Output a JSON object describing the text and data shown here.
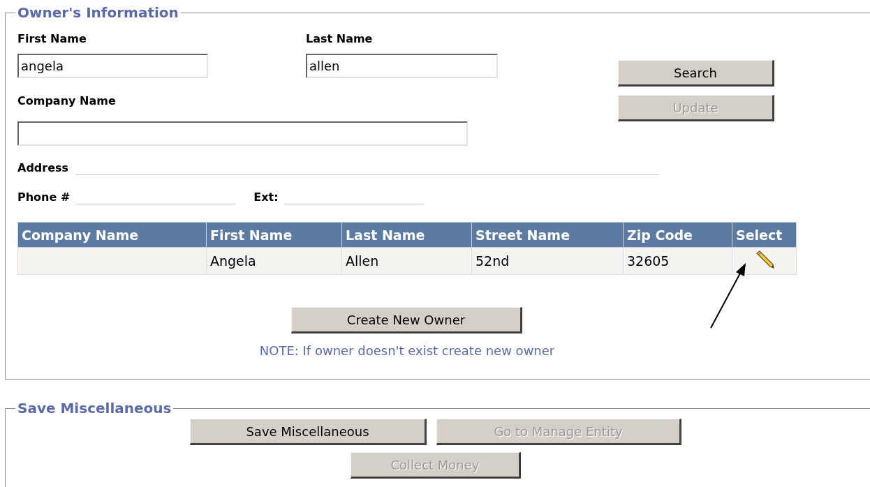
{
  "owner_information": {
    "title": "Owner's Information",
    "first_name": {
      "label": "First Name",
      "value": "angela"
    },
    "last_name": {
      "label": "Last Name",
      "value": "allen"
    },
    "company_name": {
      "label": "Company Name"
    },
    "side_buttons": [
      {
        "label": "Search",
        "disabled": false
      },
      {
        "label": "Update",
        "disabled": true
      }
    ],
    "address": {
      "label": "Address"
    },
    "phone": {
      "label": "Phone #"
    },
    "ext": {
      "label": "Ext:"
    },
    "table": {
      "columns": [
        "Company Name",
        "First Name",
        "Last Name",
        "Street Name",
        "Zip Code",
        "Select"
      ],
      "rows": [
        {
          "cells": [
            null,
            "Angela",
            "Allen",
            "52nd",
            "32605"
          ]
        }
      ]
    },
    "create_button": {
      "label": "Create New Owner",
      "disabled": false
    },
    "note": "NOTE: If owner doesn't exist create new owner"
  },
  "save_miscellaneous": {
    "title": "Save Miscellaneous",
    "buttons": [
      {
        "label": "Save Miscellaneous",
        "disabled": false
      },
      {
        "label": "Go to Manage Entity",
        "disabled": true
      },
      {
        "label": "Collect Money",
        "disabled": true
      }
    ]
  }
}
